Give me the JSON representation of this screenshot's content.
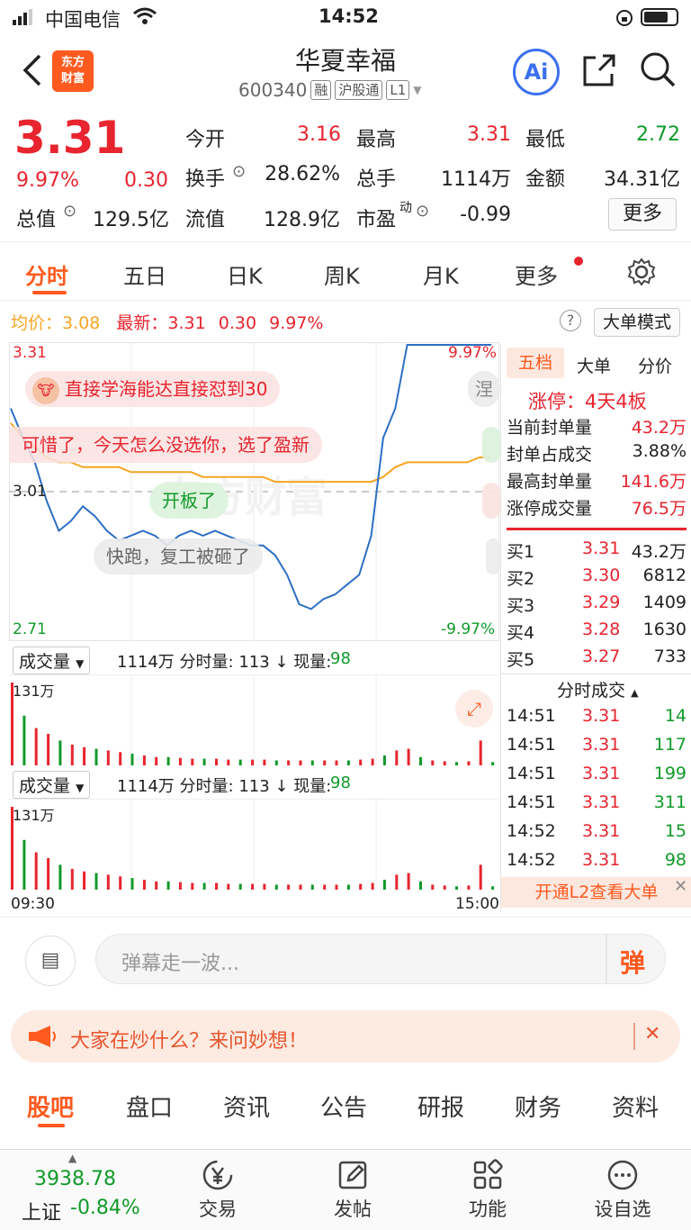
{
  "status_bar": {
    "carrier": "中国电信",
    "time": "14:52"
  },
  "header": {
    "logo_line1": "东方",
    "logo_line2": "财富",
    "title": "华夏幸福",
    "code": "600340",
    "tags": [
      "融",
      "沪股通",
      "L1"
    ],
    "ai_label": "Ai"
  },
  "quote": {
    "price": "3.31",
    "change_pct": "9.97%",
    "change": "0.30",
    "open_label": "今开",
    "open": "3.16",
    "high_label": "最高",
    "high": "3.31",
    "low_label": "最低",
    "low": "2.72",
    "turnover_label": "换手",
    "turnover": "28.62%",
    "volume_label": "总手",
    "volume": "1114万",
    "amount_label": "金额",
    "amount": "34.31亿",
    "mcap_label": "总值",
    "mcap": "129.5亿",
    "float_label": "流值",
    "float_cap": "128.9亿",
    "pe_label": "市盈",
    "pe_sup": "动",
    "pe": "-0.99",
    "more_button": "更多"
  },
  "chart_tabs": [
    "分时",
    "五日",
    "日K",
    "周K",
    "月K",
    "更多"
  ],
  "info_line": {
    "avg_label": "均价：",
    "avg": "3.08",
    "latest_label": "最新：",
    "latest": "3.31",
    "change": "0.30",
    "pct": "9.97%",
    "mode_button": "大单模式"
  },
  "chart_labels": {
    "top_price": "3.31",
    "top_pct": "9.97%",
    "mid_price": "3.01",
    "bottom_price": "2.71",
    "bottom_pct": "-9.97%",
    "start_time": "09:30",
    "end_time": "15:00"
  },
  "danmaku": [
    "直接学海能达直接怼到30",
    "可惜了，今天怎么没选你，选了盈新",
    "开板了",
    "快跑，复工被砸了"
  ],
  "volume_panels": [
    {
      "selector": "成交量",
      "summary": "1114万  分时量: 113 ↓ 现量:",
      "now": "98",
      "max": "131万"
    },
    {
      "selector": "成交量",
      "summary": "1114万  分时量: 113 ↓ 现量:",
      "now": "98",
      "max": "131万"
    }
  ],
  "right_panel": {
    "tabs": [
      "五档",
      "大单",
      "分价"
    ],
    "limit_up_label": "涨停：4天4板",
    "stats": [
      {
        "label": "当前封单量",
        "value": "43.2万"
      },
      {
        "label": "封单占成交",
        "value": "3.88%"
      },
      {
        "label": "最高封单量",
        "value": "141.6万"
      },
      {
        "label": "涨停成交量",
        "value": "76.5万"
      }
    ],
    "bids": [
      {
        "label": "买1",
        "price": "3.31",
        "vol": "43.2万"
      },
      {
        "label": "买2",
        "price": "3.30",
        "vol": "6812"
      },
      {
        "label": "买3",
        "price": "3.29",
        "vol": "1409"
      },
      {
        "label": "买4",
        "price": "3.28",
        "vol": "1630"
      },
      {
        "label": "买5",
        "price": "3.27",
        "vol": "733"
      }
    ],
    "ticks_title": "分时成交",
    "ticks": [
      {
        "time": "14:51",
        "price": "3.31",
        "vol": "14"
      },
      {
        "time": "14:51",
        "price": "3.31",
        "vol": "117"
      },
      {
        "time": "14:51",
        "price": "3.31",
        "vol": "199"
      },
      {
        "time": "14:51",
        "price": "3.31",
        "vol": "311"
      },
      {
        "time": "14:52",
        "price": "3.31",
        "vol": "15"
      },
      {
        "time": "14:52",
        "price": "3.31",
        "vol": "98"
      }
    ],
    "l2_banner": "开通L2查看大单"
  },
  "comment_bar": {
    "placeholder": "弹幕走一波...",
    "button": "弹"
  },
  "promo": {
    "text": "大家在炒什么？来问妙想！"
  },
  "bottom_tabs": [
    "股吧",
    "盘口",
    "资讯",
    "公告",
    "研报",
    "财务",
    "资料"
  ],
  "nav": {
    "index_value": "3938.78",
    "index_name": "上证",
    "index_change": "-0.84%",
    "items": [
      "交易",
      "发帖",
      "功能",
      "设自选"
    ]
  },
  "colors": {
    "up": "#e8242e",
    "down": "#119a2a",
    "accent": "#ff5a1f",
    "avg_line": "#f5a623",
    "price_line": "#2d6fc4"
  },
  "chart_data": {
    "type": "line",
    "series": [
      {
        "name": "最新",
        "values": [
          3.18,
          3.12,
          3.07,
          2.99,
          2.93,
          2.95,
          2.98,
          2.96,
          2.93,
          2.91,
          2.92,
          2.93,
          2.92,
          2.9,
          2.92,
          2.93,
          2.92,
          2.93,
          2.92,
          2.91,
          2.9,
          2.9,
          2.88,
          2.84,
          2.78,
          2.77,
          2.79,
          2.8,
          2.82,
          2.84,
          2.92,
          3.12,
          3.18,
          3.31,
          3.31,
          3.31,
          3.31,
          3.31,
          3.31,
          3.31,
          3.31
        ]
      },
      {
        "name": "均价",
        "values": [
          3.15,
          3.12,
          3.1,
          3.08,
          3.07,
          3.07,
          3.06,
          3.06,
          3.06,
          3.06,
          3.05,
          3.05,
          3.05,
          3.05,
          3.05,
          3.05,
          3.04,
          3.04,
          3.04,
          3.04,
          3.04,
          3.04,
          3.03,
          3.03,
          3.03,
          3.03,
          3.03,
          3.03,
          3.03,
          3.03,
          3.03,
          3.04,
          3.06,
          3.07,
          3.07,
          3.07,
          3.07,
          3.07,
          3.07,
          3.08,
          3.08
        ]
      }
    ],
    "ylim": [
      2.71,
      3.31
    ],
    "volume_values": [
      100,
      60,
      45,
      38,
      30,
      25,
      22,
      20,
      18,
      16,
      14,
      12,
      10,
      10,
      9,
      8,
      8,
      8,
      7,
      7,
      7,
      7,
      6,
      6,
      6,
      6,
      6,
      6,
      6,
      7,
      8,
      12,
      18,
      20,
      10,
      6,
      5,
      4,
      5,
      30,
      4
    ]
  }
}
